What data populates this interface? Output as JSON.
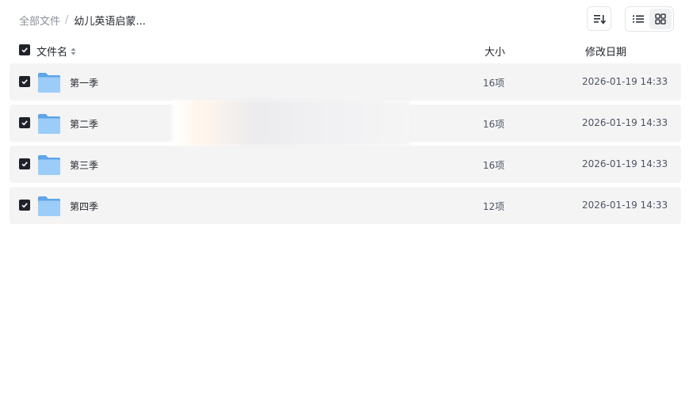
{
  "breadcrumb": {
    "root": "全部文件",
    "separator": "/",
    "current": "幼儿英语启蒙..."
  },
  "toolbar": {
    "sort_icon": "sort-list-icon",
    "list_view_icon": "list-view-icon",
    "grid_view_icon": "grid-view-icon",
    "active_view": "list"
  },
  "table": {
    "headers": {
      "name": "文件名",
      "size": "大小",
      "date": "修改日期"
    },
    "select_all_checked": true,
    "rows": [
      {
        "name": "第一季",
        "size": "16项",
        "date": "2026-01-19 14:33",
        "checked": true
      },
      {
        "name": "第二季",
        "size": "16项",
        "date": "2026-01-19 14:33",
        "checked": true
      },
      {
        "name": "第三季",
        "size": "16项",
        "date": "2026-01-19 14:33",
        "checked": true
      },
      {
        "name": "第四季",
        "size": "12项",
        "date": "2026-01-19 14:33",
        "checked": true
      }
    ]
  },
  "colors": {
    "row_background": "#f4f4f5",
    "checkbox": "#1f2329",
    "folder": "#7db9f0"
  }
}
